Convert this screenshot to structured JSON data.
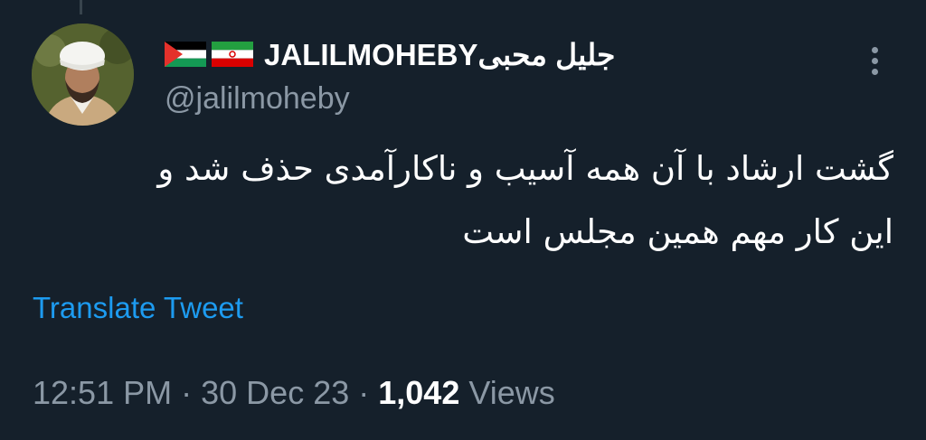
{
  "author": {
    "flags": [
      "palestine-flag",
      "iran-flag"
    ],
    "display_name": "JALILMOHEBYجلیل محبی",
    "handle": "@jalilmoheby"
  },
  "tweet": {
    "lines": [
      "گشت ارشاد با آن همه آسیب و ناکارآمدی حذف شد و",
      "این کار مهم همین مجلس است"
    ],
    "translate_label": "Translate Tweet"
  },
  "meta": {
    "time": "12:51 PM",
    "separator": "·",
    "date": "30 Dec 23",
    "views_count": "1,042",
    "views_label": "Views"
  },
  "colors": {
    "background": "#15202b",
    "primary_text": "#ffffff",
    "secondary_text": "#8b98a5",
    "link": "#1d9bf0"
  },
  "icons": {
    "more": "more-vertical-icon"
  }
}
